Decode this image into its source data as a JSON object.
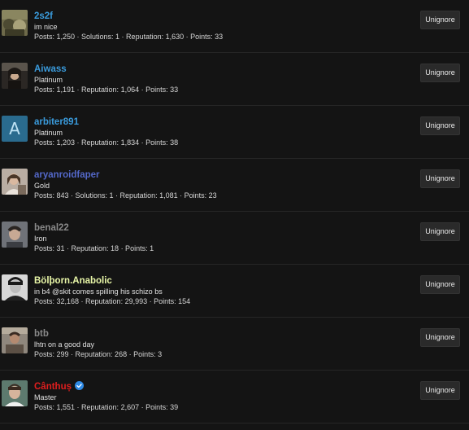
{
  "button_label": "Unignore",
  "users": [
    {
      "username": "2s2f",
      "color": "#3a9bdc",
      "title": "im nice",
      "stats": "Posts: 1,250 · Solutions: 1 · Reputation: 1,630 · Points: 33",
      "avatar": "avatar-image",
      "verified": false
    },
    {
      "username": "Aiwass",
      "color": "#3a9bdc",
      "title": "Platinum",
      "stats": "Posts: 1,191 · Reputation: 1,064 · Points: 33",
      "avatar": "avatar-image",
      "verified": false
    },
    {
      "username": "arbiter891",
      "color": "#3a9bdc",
      "title": "Platinum",
      "stats": "Posts: 1,203 · Reputation: 1,834 · Points: 38",
      "avatar": "letter-avatar",
      "avatar_letter": "A",
      "verified": false
    },
    {
      "username": "aryanroidfaper",
      "color": "#5468c9",
      "title": "Gold",
      "stats": "Posts: 843 · Solutions: 1 · Reputation: 1,081 · Points: 23",
      "avatar": "avatar-image",
      "verified": false
    },
    {
      "username": "benal22",
      "color": "#8a8a8a",
      "title": "Iron",
      "stats": "Posts: 31 · Reputation: 18 · Points: 1",
      "avatar": "avatar-image",
      "verified": false
    },
    {
      "username": "Bölþorn.Anabolic",
      "color": "#e9f7a8",
      "title": "in b4 @skit comes spilling his schizo bs",
      "stats": "Posts: 32,168 · Reputation: 29,993 · Points: 154",
      "avatar": "avatar-image",
      "verified": false
    },
    {
      "username": "btb",
      "color": "#8a8a8a",
      "title": "lhtn on a good day",
      "stats": "Posts: 299 · Reputation: 268 · Points: 3",
      "avatar": "avatar-image",
      "verified": false
    },
    {
      "username": "Cânthuș",
      "color": "#e01e1e",
      "title": "Master",
      "stats": "Posts: 1,551 · Reputation: 2,607 · Points: 39",
      "avatar": "avatar-image",
      "verified": true,
      "verified_icon": "verified-badge-icon"
    }
  ]
}
